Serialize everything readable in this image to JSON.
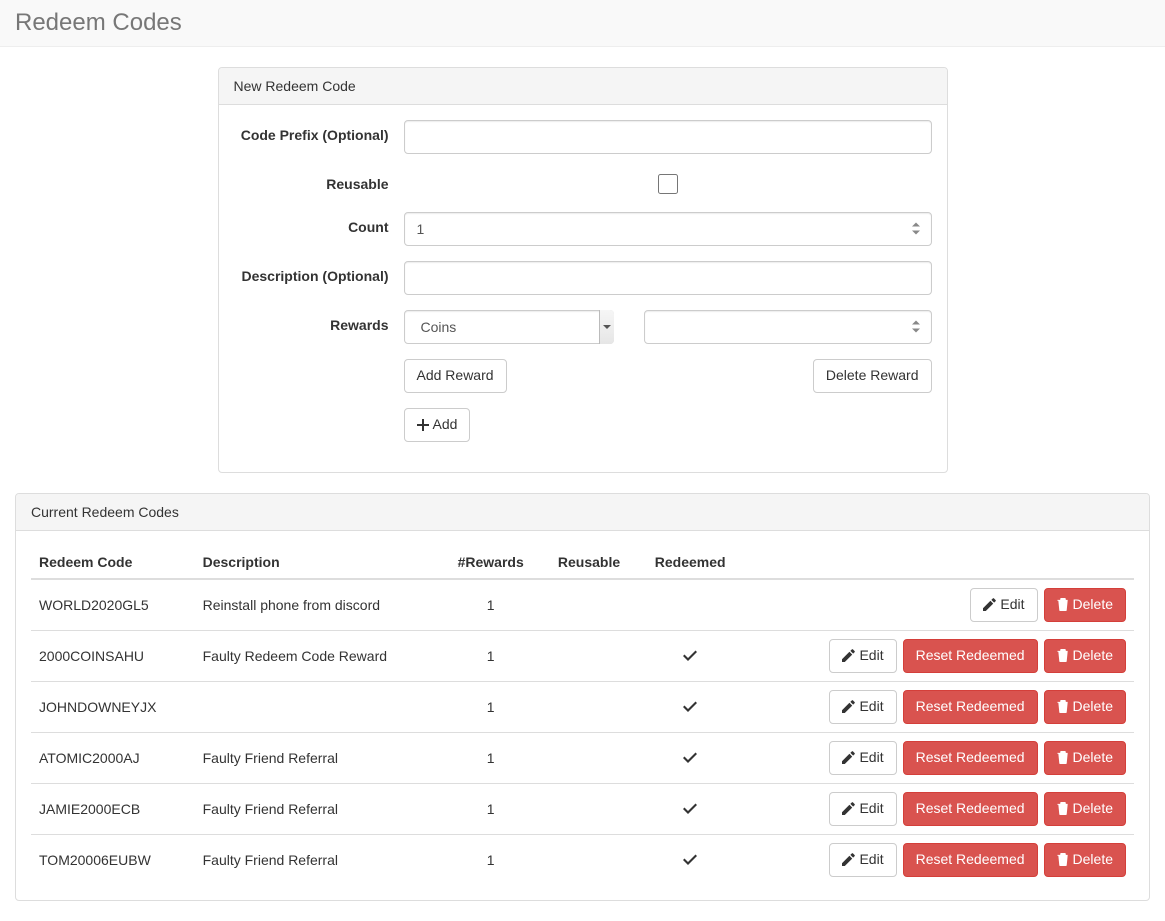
{
  "page": {
    "title": "Redeem Codes"
  },
  "form": {
    "heading": "New Redeem Code",
    "labels": {
      "prefix": "Code Prefix (Optional)",
      "reusable": "Reusable",
      "count": "Count",
      "description": "Description (Optional)",
      "rewards": "Rewards"
    },
    "values": {
      "prefix": "",
      "reusable": false,
      "count": "1",
      "description": "",
      "reward_type": "Coins",
      "reward_amount": ""
    },
    "reward_type_options": [
      "Coins"
    ],
    "buttons": {
      "add_reward": "Add Reward",
      "delete_reward": "Delete Reward",
      "add": "Add"
    }
  },
  "list": {
    "heading": "Current Redeem Codes",
    "columns": {
      "code": "Redeem Code",
      "description": "Description",
      "rewards": "#Rewards",
      "reusable": "Reusable",
      "redeemed": "Redeemed"
    },
    "action_labels": {
      "edit": "Edit",
      "reset": "Reset Redeemed",
      "delete": "Delete"
    },
    "rows": [
      {
        "code": "WORLD2020GL5",
        "description": "Reinstall phone from discord",
        "rewards": "1",
        "reusable": false,
        "redeemed": false
      },
      {
        "code": "2000COINSAHU",
        "description": "Faulty Redeem Code Reward",
        "rewards": "1",
        "reusable": false,
        "redeemed": true
      },
      {
        "code": "JOHNDOWNEYJX",
        "description": "",
        "rewards": "1",
        "reusable": false,
        "redeemed": true
      },
      {
        "code": "ATOMIC2000AJ",
        "description": "Faulty Friend Referral",
        "rewards": "1",
        "reusable": false,
        "redeemed": true
      },
      {
        "code": "JAMIE2000ECB",
        "description": "Faulty Friend Referral",
        "rewards": "1",
        "reusable": false,
        "redeemed": true
      },
      {
        "code": "TOM20006EUBW",
        "description": "Faulty Friend Referral",
        "rewards": "1",
        "reusable": false,
        "redeemed": true
      }
    ]
  },
  "icons": {
    "plus": "plus-icon",
    "edit": "pencil-square-icon",
    "trash": "trash-icon",
    "check": "check-icon"
  }
}
